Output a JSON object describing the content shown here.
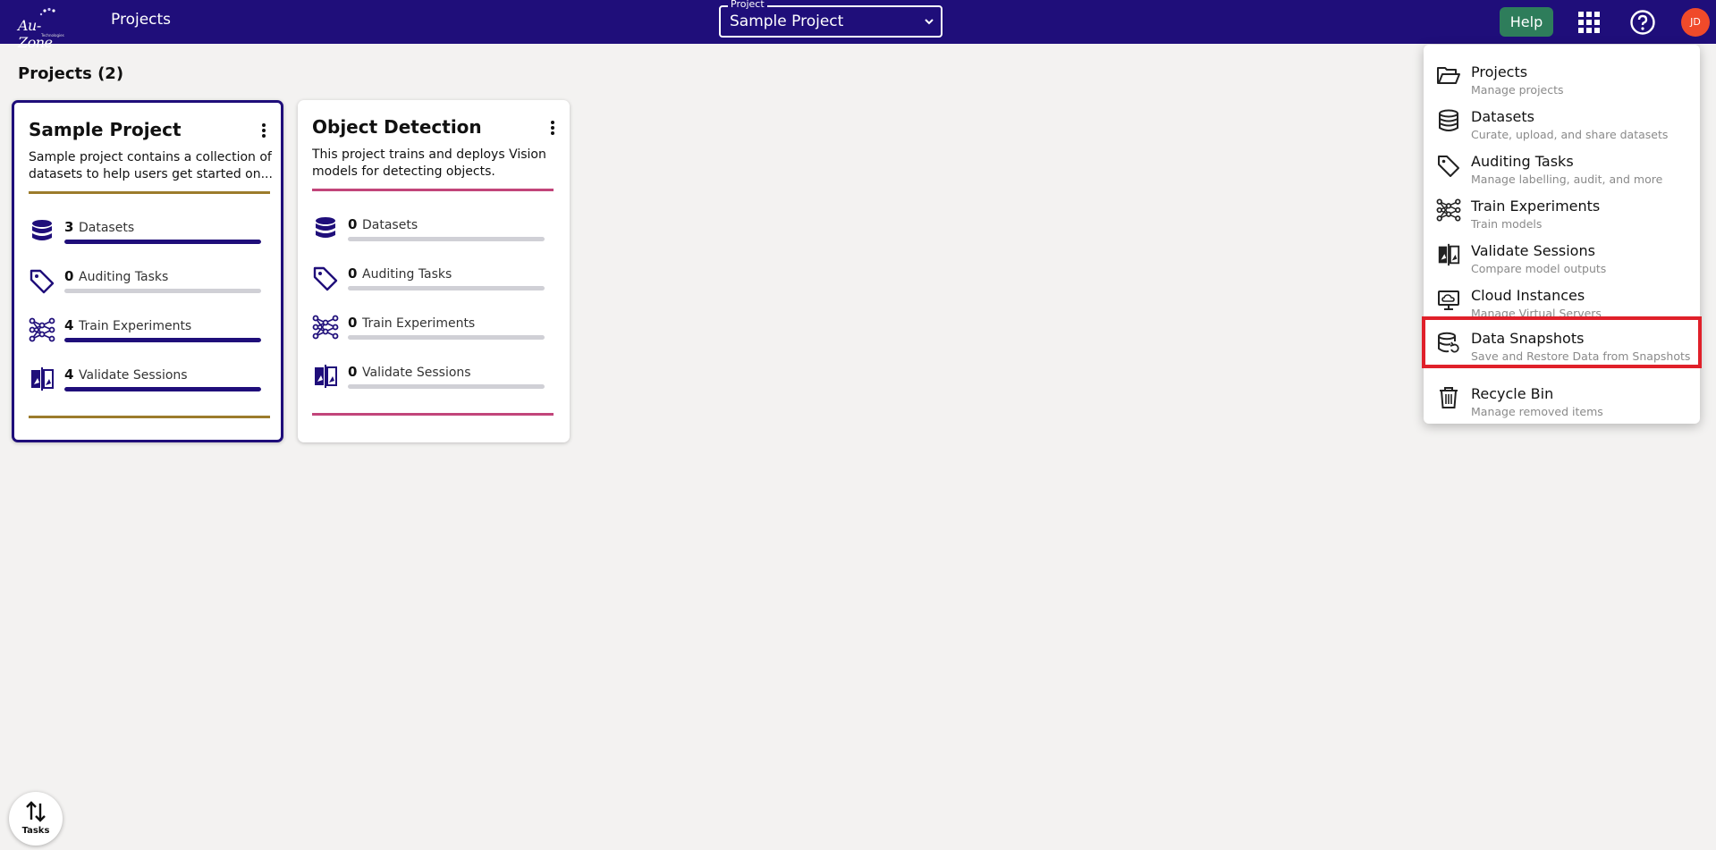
{
  "header": {
    "logo_text": "Au-Zone",
    "logo_sub": "Technologies",
    "nav_title": "Projects",
    "project_select": {
      "legend": "Project",
      "value": "Sample Project"
    },
    "help_label": "Help",
    "apps_icon": "apps-grid-icon",
    "help_icon": "help-circle-icon",
    "avatar_initials": "JD"
  },
  "main": {
    "heading": "Projects (2)",
    "projects": [
      {
        "title": "Sample Project",
        "description": "Sample project contains a collection of datasets to help users get started on...",
        "accent_color": "#9c7c2c",
        "selected": true,
        "stats": [
          {
            "icon": "database-icon",
            "count": "3",
            "label": "Datasets",
            "fill": 1.0
          },
          {
            "icon": "tag-icon",
            "count": "0",
            "label": "Auditing Tasks",
            "fill": 0.0
          },
          {
            "icon": "network-icon",
            "count": "4",
            "label": "Train Experiments",
            "fill": 1.0
          },
          {
            "icon": "compare-icon",
            "count": "4",
            "label": "Validate Sessions",
            "fill": 1.0
          }
        ]
      },
      {
        "title": "Object Detection",
        "description": "This project trains and deploys Vision models for detecting objects.",
        "accent_color": "#c2457a",
        "selected": false,
        "stats": [
          {
            "icon": "database-icon",
            "count": "0",
            "label": "Datasets",
            "fill": 0.0
          },
          {
            "icon": "tag-icon",
            "count": "0",
            "label": "Auditing Tasks",
            "fill": 0.0
          },
          {
            "icon": "network-icon",
            "count": "0",
            "label": "Train Experiments",
            "fill": 0.0
          },
          {
            "icon": "compare-icon",
            "count": "0",
            "label": "Validate Sessions",
            "fill": 0.0
          }
        ]
      }
    ]
  },
  "apps_menu": {
    "items": [
      {
        "icon": "folder-open-icon",
        "label": "Projects",
        "sub": "Manage projects"
      },
      {
        "icon": "database-icon",
        "label": "Datasets",
        "sub": "Curate, upload, and share datasets"
      },
      {
        "icon": "tag-icon",
        "label": "Auditing Tasks",
        "sub": "Manage labelling, audit, and more"
      },
      {
        "icon": "network-icon",
        "label": "Train Experiments",
        "sub": "Train models"
      },
      {
        "icon": "compare-icon",
        "label": "Validate Sessions",
        "sub": "Compare model outputs"
      },
      {
        "icon": "cloud-monitor-icon",
        "label": "Cloud Instances",
        "sub": "Manage Virtual Servers"
      },
      {
        "icon": "database-restore-icon",
        "label": "Data Snapshots",
        "sub": "Save and Restore Data from Snapshots",
        "highlighted": true
      },
      {
        "icon": "trash-icon",
        "label": "Recycle Bin",
        "sub": "Manage removed items"
      }
    ]
  },
  "tasks_fab": {
    "label": "Tasks",
    "icon": "swap-vertical-icon"
  },
  "colors": {
    "header_bg": "#1f0e7a",
    "help_bg": "#2e7d5b",
    "avatar_bg": "#f04a2a",
    "highlight": "#e0202a"
  }
}
